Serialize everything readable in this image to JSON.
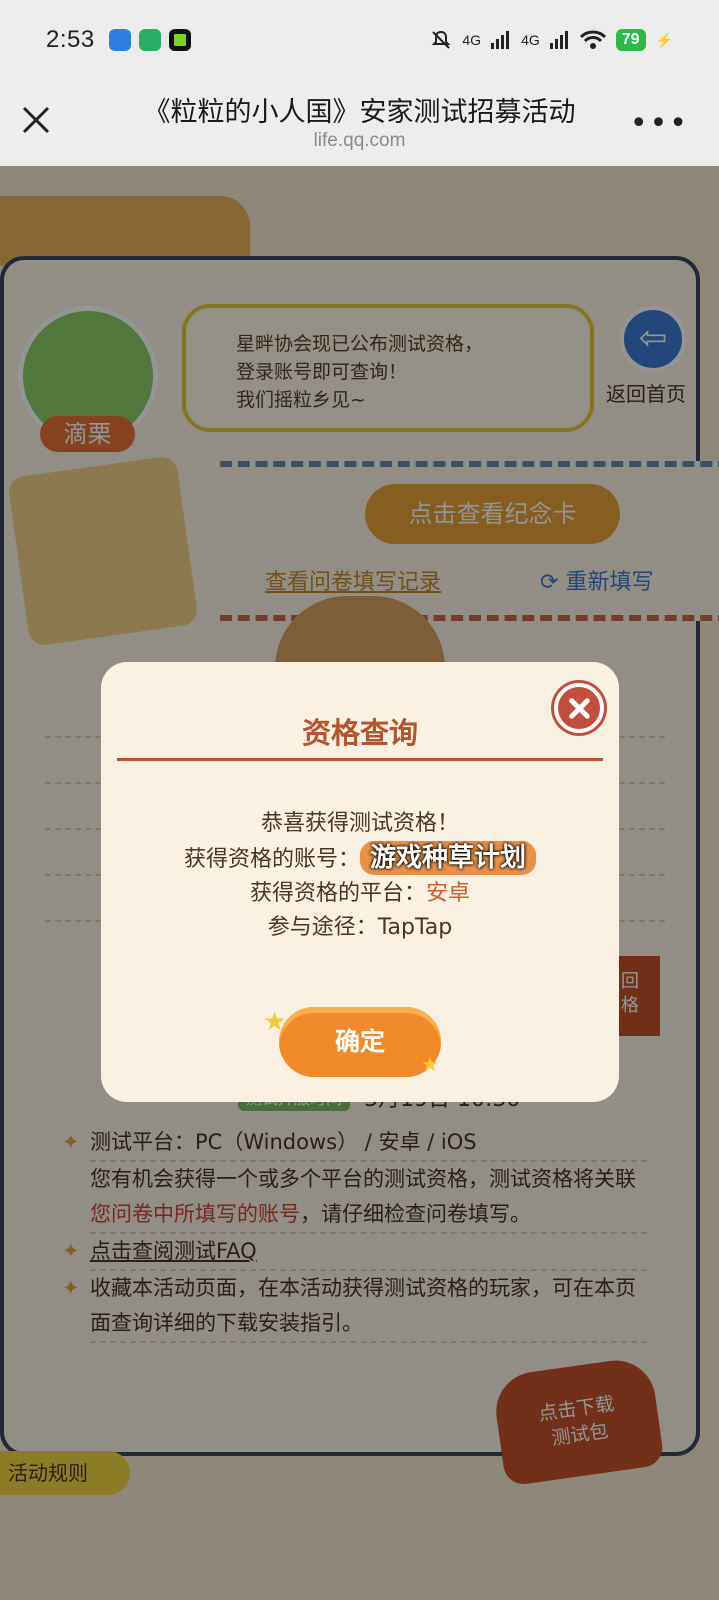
{
  "status_bar": {
    "time": "2:53",
    "net1": "4G",
    "net2": "4G",
    "battery": "79"
  },
  "titlebar": {
    "title": "《粒粒的小人国》安家测试招募活动",
    "url": "life.qq.com",
    "more": "•••"
  },
  "page": {
    "avatar_name": "滴栗",
    "bubble_lines": [
      "星畔协会现已公布测试资格，",
      "登录账号即可查询！",
      "我们摇粒乡见~"
    ],
    "back_label": "返回首页",
    "card_button": "点击查看纪念卡",
    "link_history": "查看问卷填写记录",
    "link_refill": "重新填写",
    "side_button": "回\n格",
    "info_tag": "测试开服时间",
    "info_date": "3月19日  10:30",
    "info_platforms": "测试平台：PC（Windows） / 安卓 / iOS",
    "info_desc_pre": "您有机会获得一个或多个平台的测试资格，测试资格将关联",
    "info_desc_link": "您问卷中所填写的账号",
    "info_desc_post": "，请仔细检查问卷填写。",
    "info_faq": "点击查阅测试FAQ",
    "info_bookmark": "收藏本活动页面，在本活动获得测试资格的玩家，可在本页面查询详细的下载安装指引。",
    "download_button": "点击下载\n测试包",
    "rules_tab": "活动规则"
  },
  "dialog": {
    "title": "资格查询",
    "congrats": "恭喜获得测试资格！",
    "account_label": "获得资格的账号：",
    "account_value": "游戏种草计划",
    "platform_label": "获得资格的平台：",
    "platform_value": "安卓",
    "channel_label": "参与途径：",
    "channel_value": "TapTap",
    "confirm": "确定"
  }
}
